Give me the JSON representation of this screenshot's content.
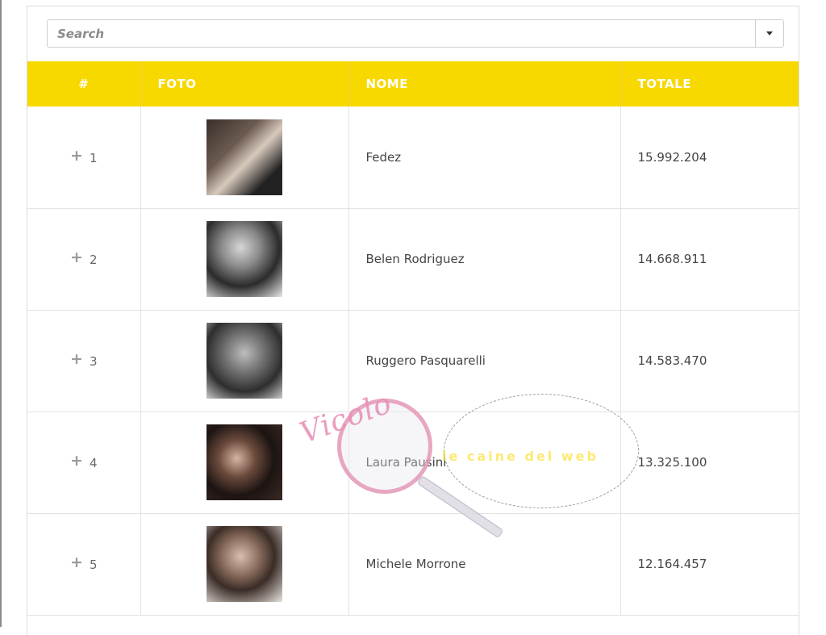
{
  "search": {
    "placeholder": "Search"
  },
  "table": {
    "headers": {
      "rank": "#",
      "photo": "FOTO",
      "name": "NOME",
      "total": "TOTALE"
    },
    "rows": [
      {
        "rank": "1",
        "name": "Fedez",
        "total": "15.992.204"
      },
      {
        "rank": "2",
        "name": "Belen Rodriguez",
        "total": "14.668.911"
      },
      {
        "rank": "3",
        "name": "Ruggero Pasquarelli",
        "total": "14.583.470"
      },
      {
        "rank": "4",
        "name": "Laura Pausini",
        "total": "13.325.100"
      },
      {
        "rank": "5",
        "name": "Michele Morrone",
        "total": "12.164.457"
      }
    ]
  },
  "watermark": {
    "title": "Vicolo",
    "sub": "le caine del web"
  },
  "colors": {
    "header_bg": "#f7d900",
    "header_text": "#ffffff",
    "watermark_pink": "#e28bb0"
  }
}
